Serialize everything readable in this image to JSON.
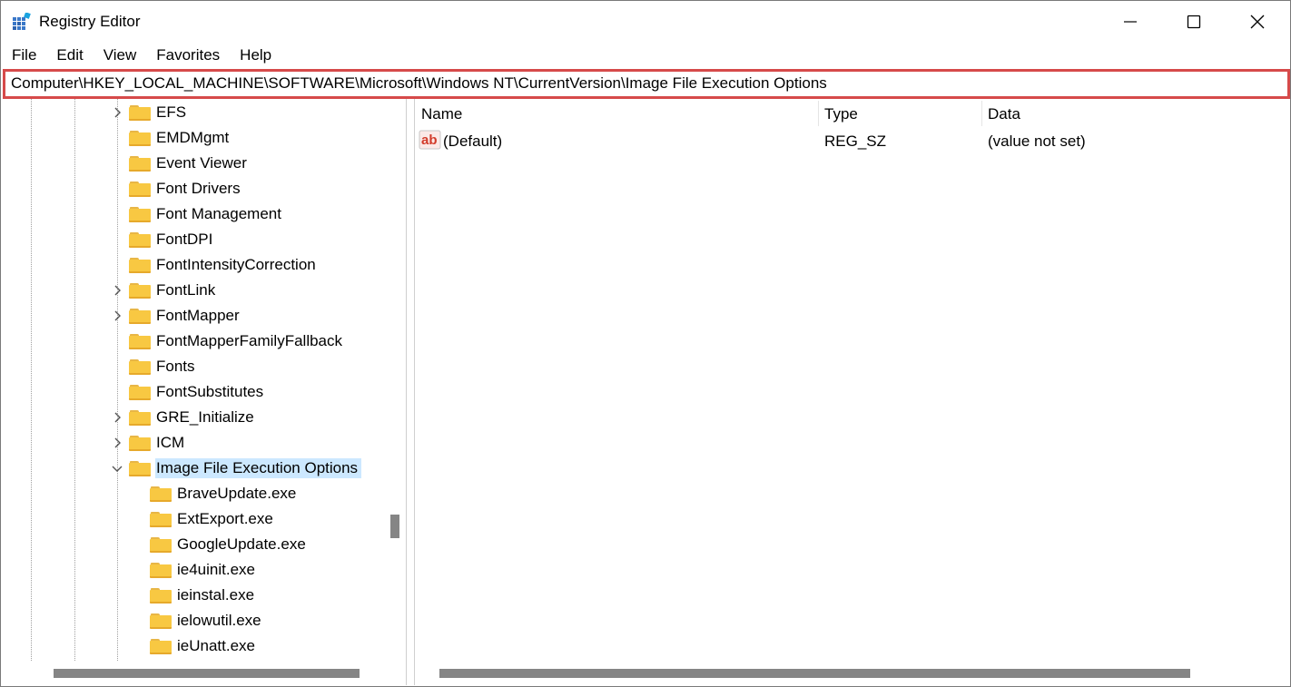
{
  "window": {
    "title": "Registry Editor",
    "controls": {
      "minimize": "minimize",
      "maximize": "maximize",
      "close": "close"
    }
  },
  "menu": [
    "File",
    "Edit",
    "View",
    "Favorites",
    "Help"
  ],
  "address": "Computer\\HKEY_LOCAL_MACHINE\\SOFTWARE\\Microsoft\\Windows NT\\CurrentVersion\\Image File Execution Options",
  "tree": {
    "items": [
      {
        "label": "EFS",
        "expander": "collapsed"
      },
      {
        "label": "EMDMgmt",
        "expander": "none"
      },
      {
        "label": "Event Viewer",
        "expander": "none"
      },
      {
        "label": "Font Drivers",
        "expander": "none"
      },
      {
        "label": "Font Management",
        "expander": "none"
      },
      {
        "label": "FontDPI",
        "expander": "none"
      },
      {
        "label": "FontIntensityCorrection",
        "expander": "none"
      },
      {
        "label": "FontLink",
        "expander": "collapsed"
      },
      {
        "label": "FontMapper",
        "expander": "collapsed"
      },
      {
        "label": "FontMapperFamilyFallback",
        "expander": "none"
      },
      {
        "label": "Fonts",
        "expander": "none"
      },
      {
        "label": "FontSubstitutes",
        "expander": "none"
      },
      {
        "label": "GRE_Initialize",
        "expander": "collapsed"
      },
      {
        "label": "ICM",
        "expander": "collapsed"
      },
      {
        "label": "Image File Execution Options",
        "expander": "expanded",
        "selected": true
      }
    ],
    "children": [
      "BraveUpdate.exe",
      "ExtExport.exe",
      "GoogleUpdate.exe",
      "ie4uinit.exe",
      "ieinstal.exe",
      "ielowutil.exe",
      "ieUnatt.exe"
    ]
  },
  "list": {
    "columns": [
      "Name",
      "Type",
      "Data"
    ],
    "rows": [
      {
        "name": "(Default)",
        "type": "REG_SZ",
        "data": "(value not set)",
        "icon": "string-value-icon"
      }
    ]
  },
  "colors": {
    "address_highlight": "#d64a4a",
    "selection": "#cce8ff",
    "folder": "#f8c842",
    "scrollbar_thumb": "#858585"
  }
}
